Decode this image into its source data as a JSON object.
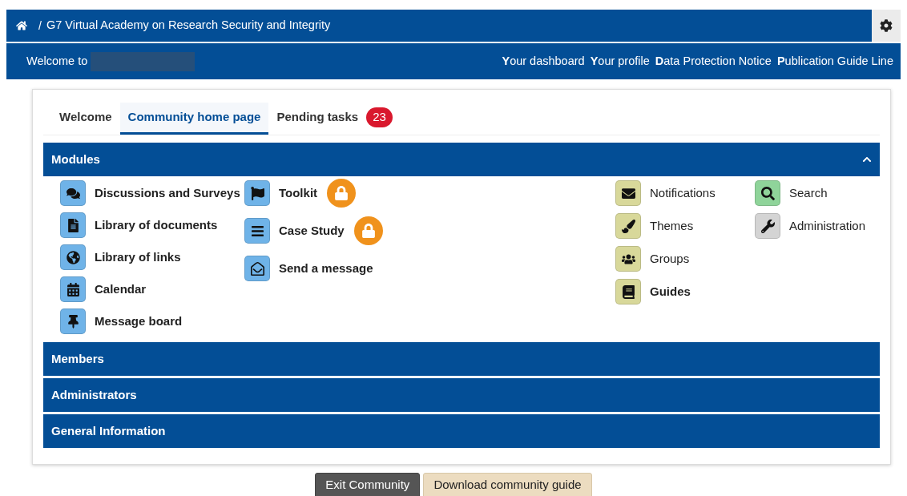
{
  "breadcrumb": {
    "separator": "/",
    "title": "G7 Virtual Academy on Research Security and Integrity"
  },
  "welcome": {
    "label": "Welcome to"
  },
  "nav_links": [
    "**Y**our dashboard",
    "**Y**our profile",
    "**D**ata Protection Notice",
    "**P**ublication Guide Line"
  ],
  "tabs": [
    {
      "label": "Welcome",
      "selected": false
    },
    {
      "label": "Community home page",
      "selected": true
    },
    {
      "label": "Pending tasks",
      "selected": false,
      "badge": "23"
    }
  ],
  "sections": [
    {
      "title": "Modules",
      "expanded": true,
      "columns": [
        [
          {
            "label": "Discussions and Surveys",
            "bold": true,
            "locked": false,
            "color": "#6fb3e8"
          },
          {
            "label": "Library of documents",
            "bold": true,
            "locked": false,
            "color": "#6fb3e8"
          },
          {
            "label": "Library of links",
            "bold": true,
            "locked": false,
            "color": "#6fb3e8"
          },
          {
            "label": "Calendar",
            "bold": true,
            "locked": false,
            "color": "#6fb3e8"
          },
          {
            "label": "Message board",
            "bold": true,
            "locked": false,
            "color": "#6fb3e8"
          }
        ],
        [
          {
            "label": "Toolkit",
            "bold": true,
            "locked": true,
            "color": "#6fb3e8"
          },
          {
            "label": "Case Study",
            "bold": true,
            "locked": true,
            "color": "#6fb3e8"
          },
          {
            "label": "Send a message",
            "bold": true,
            "locked": false,
            "color": "#6fb3e8"
          }
        ],
        [
          {
            "label": "Notifications",
            "bold": false,
            "locked": false,
            "color": "#d8d89a"
          },
          {
            "label": "Themes",
            "bold": false,
            "locked": false,
            "color": "#d8d89a"
          },
          {
            "label": "Groups",
            "bold": false,
            "locked": false,
            "color": "#d8d89a"
          },
          {
            "label": "Guides",
            "bold": true,
            "locked": false,
            "color": "#d8d89a"
          }
        ],
        [
          {
            "label": "Search",
            "bold": false,
            "locked": false,
            "color": "#8fd49a"
          },
          {
            "label": "Administration",
            "bold": false,
            "locked": false,
            "color": "#d4d4d4"
          }
        ]
      ]
    },
    {
      "title": "Members",
      "expanded": false
    },
    {
      "title": "Administrators",
      "expanded": false
    },
    {
      "title": "General Information",
      "expanded": false
    }
  ],
  "buttons": [
    {
      "label": "Exit Community",
      "kind": "dark"
    },
    {
      "label": "Download community guide",
      "kind": "light"
    }
  ]
}
